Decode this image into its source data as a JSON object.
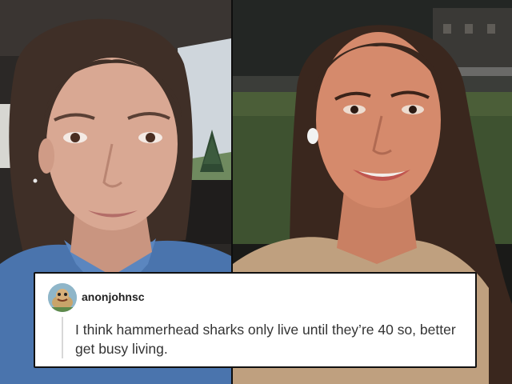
{
  "photos": {
    "left": {
      "scene": "car-interior",
      "colors": {
        "skin": "#d9a893",
        "hair": "#3f2f27",
        "shirt": "#4a74ad"
      }
    },
    "right": {
      "scene": "outdoor-night",
      "colors": {
        "skin": "#d58a6c",
        "hair": "#3a271e",
        "top": "#bfa07f"
      }
    }
  },
  "comment": {
    "username": "anonjohnsc",
    "text": "I think hammerhead sharks only live until they’re 40 so, better get busy living."
  }
}
